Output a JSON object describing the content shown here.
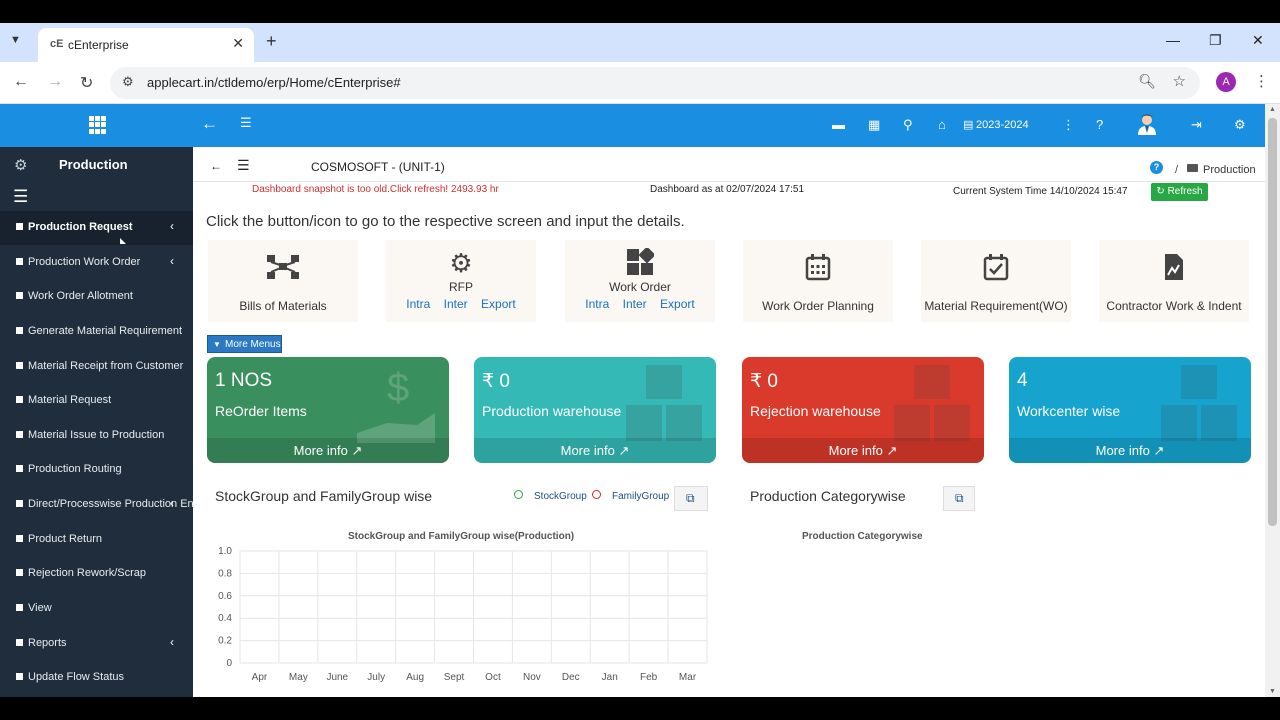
{
  "browser": {
    "tab_title": "cEnterprise",
    "favicon": "cE",
    "url": "applecart.in/ctldemo/erp/Home/cEnterprise#",
    "profile_initial": "A"
  },
  "header": {
    "fiscal_year": "2023-2024"
  },
  "sidebar": {
    "module_title": "Production",
    "items": [
      {
        "label": "Production Request",
        "has_submenu": true,
        "active": true
      },
      {
        "label": "Production Work Order",
        "has_submenu": true
      },
      {
        "label": "Work Order Allotment"
      },
      {
        "label": "Generate Material Requirement"
      },
      {
        "label": "Material Receipt from Customer"
      },
      {
        "label": "Material Request"
      },
      {
        "label": "Material Issue to Production"
      },
      {
        "label": "Production Routing"
      },
      {
        "label": "Direct/Processwise Production Entry",
        "has_submenu": true
      },
      {
        "label": "Product Return"
      },
      {
        "label": "Rejection Rework/Scrap"
      },
      {
        "label": "View"
      },
      {
        "label": "Reports",
        "has_submenu": true
      },
      {
        "label": "Update Flow Status"
      }
    ]
  },
  "main": {
    "company": "COSMOSOFT - (UNIT-1)",
    "breadcrumb": "Production",
    "warning": "Dashboard snapshot is too old.Click refresh! 2493.93 hr",
    "dashboard_as_at": "Dashboard as at 02/07/2024 17:51",
    "system_time": "Current System Time 14/10/2024 15:47",
    "refresh_label": "Refresh",
    "instruction": "Click the button/icon to go to the respective screen and input the details.",
    "more_menus": "More Menus",
    "quick_tiles": [
      {
        "label": "Bills of Materials",
        "icon": "sitemap-icon"
      },
      {
        "label": "RFP",
        "icon": "gears-icon",
        "links": [
          "Intra",
          "Inter",
          "Export"
        ]
      },
      {
        "label": "Work Order",
        "icon": "th-large-icon",
        "links": [
          "Intra",
          "Inter",
          "Export"
        ]
      },
      {
        "label": "Work Order Planning",
        "icon": "calendar-icon"
      },
      {
        "label": "Material Requirement(WO)",
        "icon": "calendar-check-icon"
      },
      {
        "label": "Contractor Work & Indent",
        "icon": "file-chart-icon"
      }
    ],
    "cards": [
      {
        "value": "1 NOS",
        "label": "ReOrder Items",
        "more": "More info",
        "color": "#3a8f5f"
      },
      {
        "value": "₹ 0",
        "label": "Production warehouse",
        "more": "More info",
        "color": "#35b9b6"
      },
      {
        "value": "₹ 0",
        "label": "Rejection warehouse",
        "more": "More info",
        "color": "#d93a2b"
      },
      {
        "value": "4",
        "label": "Workcenter wise",
        "more": "More info",
        "color": "#16a4cf"
      }
    ],
    "panel1": {
      "title": "StockGroup and FamilyGroup wise",
      "legend": [
        "StockGroup",
        "FamilyGroup"
      ]
    },
    "panel2": {
      "title": "Production Categorywise"
    }
  },
  "chart_data": [
    {
      "type": "line",
      "title": "StockGroup and FamilyGroup wise(Production)",
      "categories": [
        "Apr",
        "May",
        "June",
        "July",
        "Aug",
        "Sept",
        "Oct",
        "Nov",
        "Dec",
        "Jan",
        "Feb",
        "Mar"
      ],
      "yticks": [
        "1.0",
        "0.8",
        "0.6",
        "0.4",
        "0.2",
        "0"
      ],
      "ylim": [
        0,
        1
      ],
      "grid": true,
      "series": [
        {
          "name": "StockGroup",
          "values": []
        },
        {
          "name": "FamilyGroup",
          "values": []
        }
      ]
    },
    {
      "type": "pie",
      "title": "Production Categorywise",
      "values": []
    }
  ]
}
